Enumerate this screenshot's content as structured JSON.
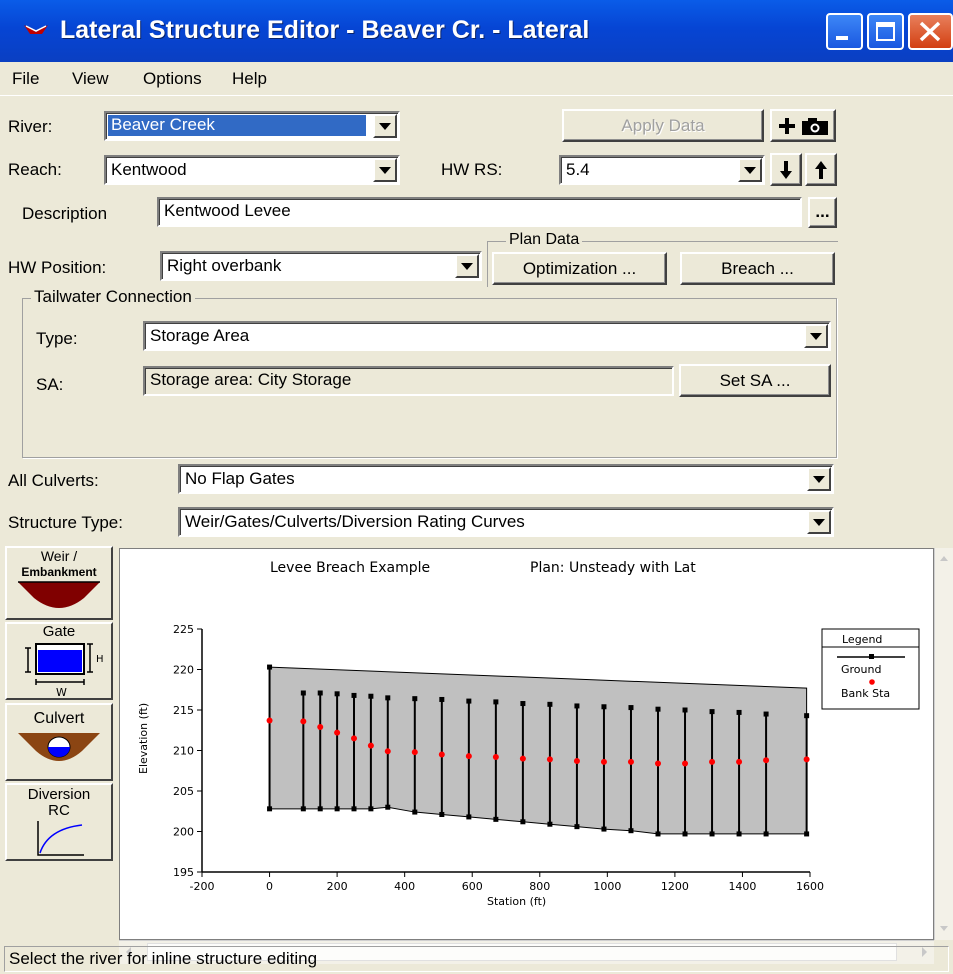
{
  "window": {
    "title": "Lateral Structure Editor - Beaver Cr.  - Lateral",
    "controls": {
      "minimize": "minimize-icon",
      "maximize": "maximize-icon",
      "close": "close-icon"
    }
  },
  "menu": [
    "File",
    "View",
    "Options",
    "Help"
  ],
  "form": {
    "river_label": "River:",
    "river_value": "Beaver Creek",
    "apply_label": "Apply Data",
    "reach_label": "Reach:",
    "reach_value": "Kentwood",
    "hwrs_label": "HW RS:",
    "hwrs_value": "5.4",
    "description_label": "Description",
    "description_value": "Kentwood Levee",
    "ellipsis": "...",
    "hw_position_label": "HW Position:",
    "hw_position_value": "Right overbank",
    "plan_data_label": "Plan Data",
    "optimization_label": "Optimization ...",
    "breach_label": "Breach ...",
    "tailwater_label": "Tailwater Connection",
    "type_label": "Type:",
    "type_value": "Storage Area",
    "sa_label": "SA:",
    "sa_value": "Storage area: City Storage",
    "set_sa_label": "Set SA ...",
    "culverts_label": "All Culverts:",
    "culverts_value": "No Flap Gates",
    "structure_type_label": "Structure Type:",
    "structure_type_value": "Weir/Gates/Culverts/Diversion Rating Curves"
  },
  "tools": {
    "weir": [
      "Weir /",
      "Embankment"
    ],
    "gate": "Gate",
    "gate_h": "H",
    "gate_w": "W",
    "culvert": "Culvert",
    "diversion": [
      "Diversion",
      "RC"
    ]
  },
  "chart_data": {
    "type": "line",
    "title": "Levee Breach Example",
    "subtitle": "Plan: Unsteady with Lat",
    "xlabel": "Station (ft)",
    "ylabel": "Elevation (ft)",
    "xlim": [
      -200,
      1600
    ],
    "ylim": [
      195,
      225
    ],
    "xticks": [
      -200,
      0,
      200,
      400,
      600,
      800,
      1000,
      1200,
      1400,
      1600
    ],
    "yticks": [
      195,
      200,
      205,
      210,
      215,
      220,
      225
    ],
    "legend_title": "Legend",
    "legend_position": "right",
    "series": [
      {
        "name": "Ground",
        "color": "#000000",
        "x": [
          0,
          100,
          150,
          200,
          250,
          300,
          350,
          430,
          510,
          590,
          670,
          750,
          830,
          910,
          990,
          1070,
          1150,
          1230,
          1310,
          1390,
          1470,
          1590
        ],
        "top": [
          220.3,
          217.1,
          217.1,
          217.0,
          216.8,
          216.7,
          216.5,
          216.4,
          216.3,
          216.1,
          216.0,
          215.8,
          215.7,
          215.5,
          215.4,
          215.3,
          215.1,
          215.0,
          214.8,
          214.7,
          214.5,
          214.3
        ],
        "bottom": [
          202.8,
          202.8,
          202.8,
          202.8,
          202.8,
          202.8,
          203.0,
          202.4,
          202.1,
          201.8,
          201.5,
          201.2,
          200.9,
          200.6,
          200.3,
          200.1,
          199.7,
          199.7,
          199.7,
          199.7,
          199.7,
          199.7
        ],
        "top_envelope_end": 217.7
      },
      {
        "name": "Bank Sta",
        "color": "#ff0000",
        "x": [
          0,
          100,
          150,
          200,
          250,
          300,
          350,
          430,
          510,
          590,
          670,
          750,
          830,
          910,
          990,
          1070,
          1150,
          1230,
          1310,
          1390,
          1470,
          1590
        ],
        "values": [
          213.7,
          213.6,
          212.9,
          212.2,
          211.5,
          210.6,
          209.9,
          209.8,
          209.5,
          209.3,
          209.2,
          209.0,
          208.9,
          208.7,
          208.6,
          208.6,
          208.4,
          208.4,
          208.6,
          208.6,
          208.8,
          208.9
        ]
      }
    ]
  },
  "status": "Select the river for inline structure editing",
  "colors": {
    "titlebar": "#0a4fd6",
    "selection": "#316ac5",
    "fill": "#c0c0c0",
    "bank": "#ff0000"
  }
}
